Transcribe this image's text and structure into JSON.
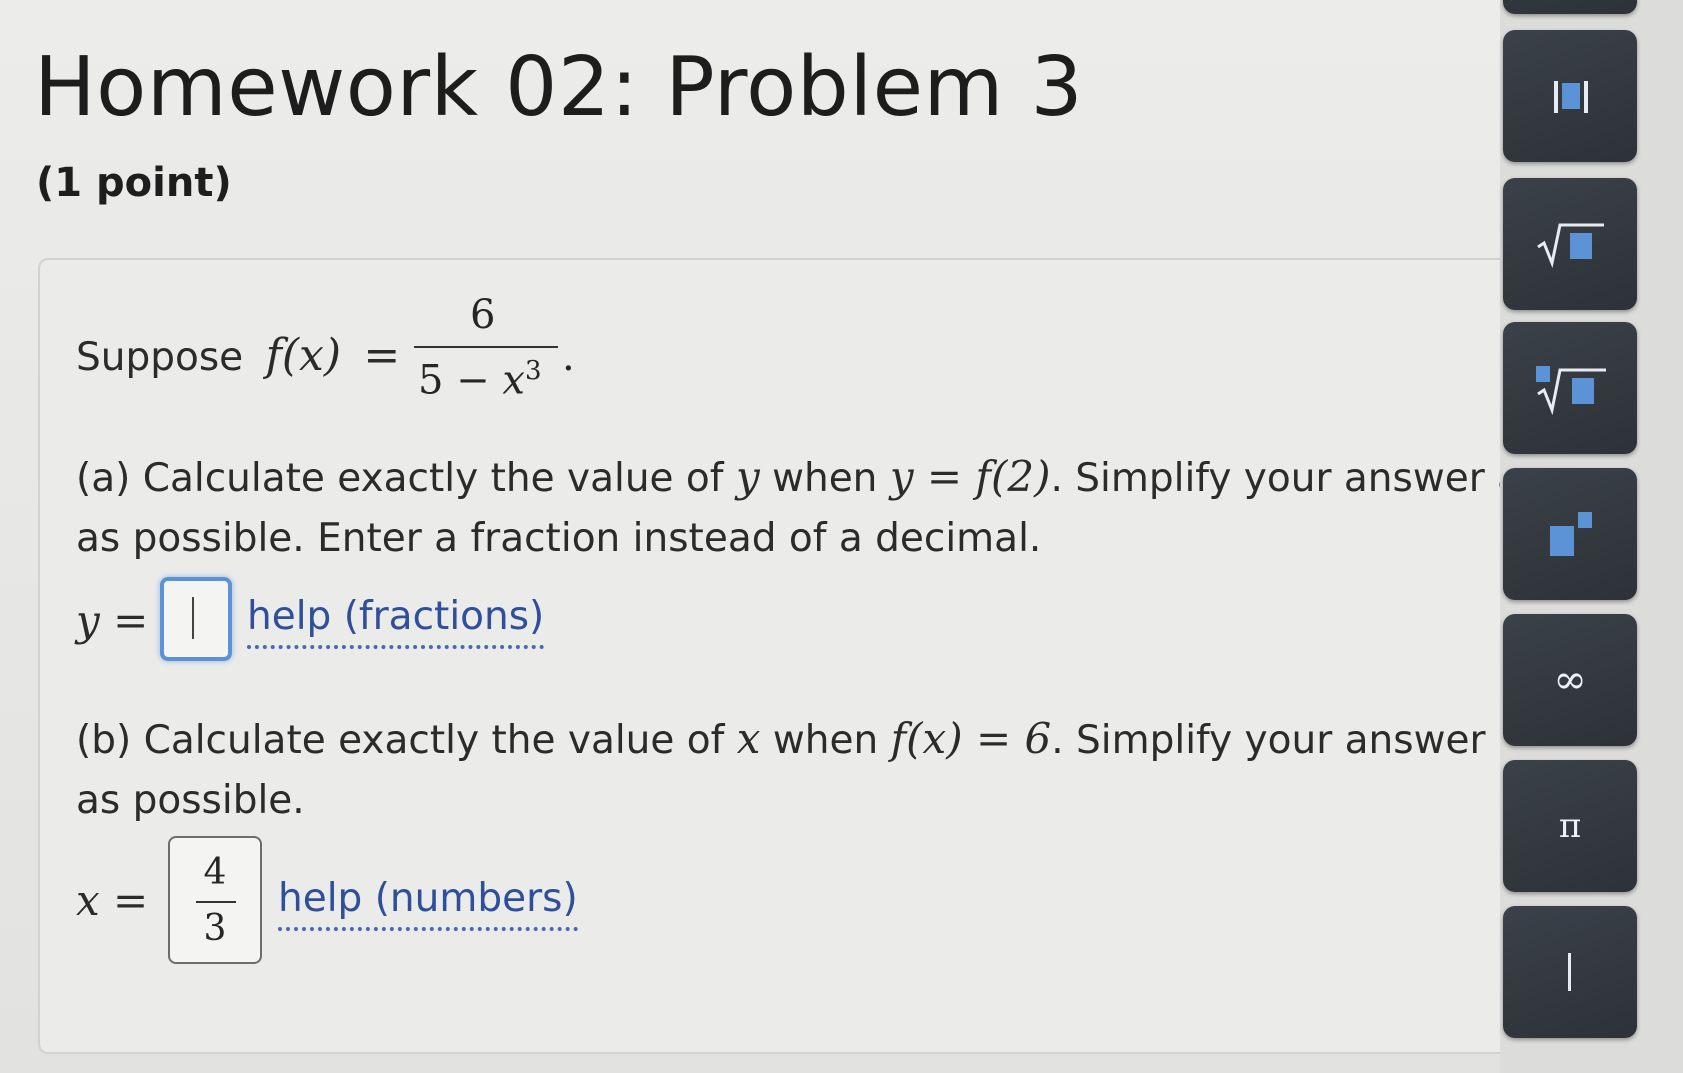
{
  "header": {
    "title": "Homework 02: Problem 3",
    "points": "(1 point)"
  },
  "problem": {
    "suppose": "Suppose",
    "function_lhs": "f(x)",
    "equals": "=",
    "numerator": "6",
    "denominator_const": "5 −",
    "denominator_var": "x",
    "denominator_exp": "3",
    "period": ".",
    "part_a": {
      "line1_pre": "(a) Calculate exactly the value of",
      "var_y": "y",
      "when": "when",
      "condition": "y = f(2)",
      "line1_post": ". Simplify your answer as",
      "line2": "as possible. Enter a fraction instead of a decimal.",
      "answer_label": "y =",
      "answer_value": "",
      "help_link": "help (fractions)"
    },
    "part_b": {
      "line1_pre": "(b) Calculate exactly the value of",
      "var_x": "x",
      "when": "when",
      "condition": "f(x) = 6",
      "line1_post": ". Simplify your answer as",
      "line2": "as possible.",
      "answer_label": "x =",
      "answer_numerator": "4",
      "answer_denominator": "3",
      "help_link": "help (numbers)"
    }
  },
  "toolbar": {
    "tools": [
      {
        "icon": "fraction-icon"
      },
      {
        "icon": "square-root-icon"
      },
      {
        "icon": "nth-root-icon"
      },
      {
        "icon": "exponent-icon"
      },
      {
        "icon": "infinity-icon",
        "symbol": "∞"
      },
      {
        "icon": "pi-icon",
        "symbol": "π"
      },
      {
        "icon": "absolute-value-icon"
      }
    ],
    "colors": {
      "tile": "#343a40",
      "accent": "#5b93d6"
    }
  }
}
